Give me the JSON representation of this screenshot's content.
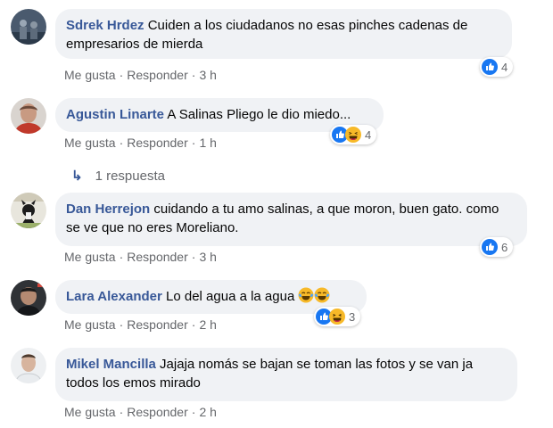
{
  "comments": [
    {
      "author": "Sdrek Hrdez",
      "text": "Cuiden a los ciudadanos no esas pinches cadenas de empresarios de mierda",
      "like_label": "Me gusta",
      "reply_label": "Responder",
      "time": "3 h",
      "reactions": [
        "like-icon"
      ],
      "reaction_count": "4"
    },
    {
      "author": "Agustin Linarte",
      "text": "A Salinas Pliego le dio miedo...",
      "like_label": "Me gusta",
      "reply_label": "Responder",
      "time": "1 h",
      "reactions": [
        "like-icon",
        "haha-icon"
      ],
      "reaction_count": "4"
    },
    {
      "author": "Dan Herrejon",
      "text": "cuidando a tu amo salinas, a que moron, buen gato. como se ve que no eres Moreliano.",
      "like_label": "Me gusta",
      "reply_label": "Responder",
      "time": "3 h",
      "reactions": [
        "like-icon"
      ],
      "reaction_count": "6"
    },
    {
      "author": "Lara Alexander",
      "text": "Lo del agua a la agua",
      "inline_emojis": [
        "laughing-tears-icon",
        "laughing-tears-icon"
      ],
      "like_label": "Me gusta",
      "reply_label": "Responder",
      "time": "2 h",
      "reactions": [
        "like-icon",
        "haha-icon"
      ],
      "reaction_count": "3"
    },
    {
      "author": "Mikel Mancilla",
      "text": "Jajaja nomás se bajan se toman las fotos y se van ja todos los emos mirado",
      "like_label": "Me gusta",
      "reply_label": "Responder",
      "time": "2 h",
      "reactions": [],
      "reaction_count": ""
    }
  ],
  "replies_link": "1 respuesta",
  "separator": "·",
  "colors": {
    "author": "#385898",
    "bubble": "#f0f2f5",
    "meta": "#65676b",
    "like_blue": "#1877f2",
    "haha_yellow": "#f7b928"
  }
}
